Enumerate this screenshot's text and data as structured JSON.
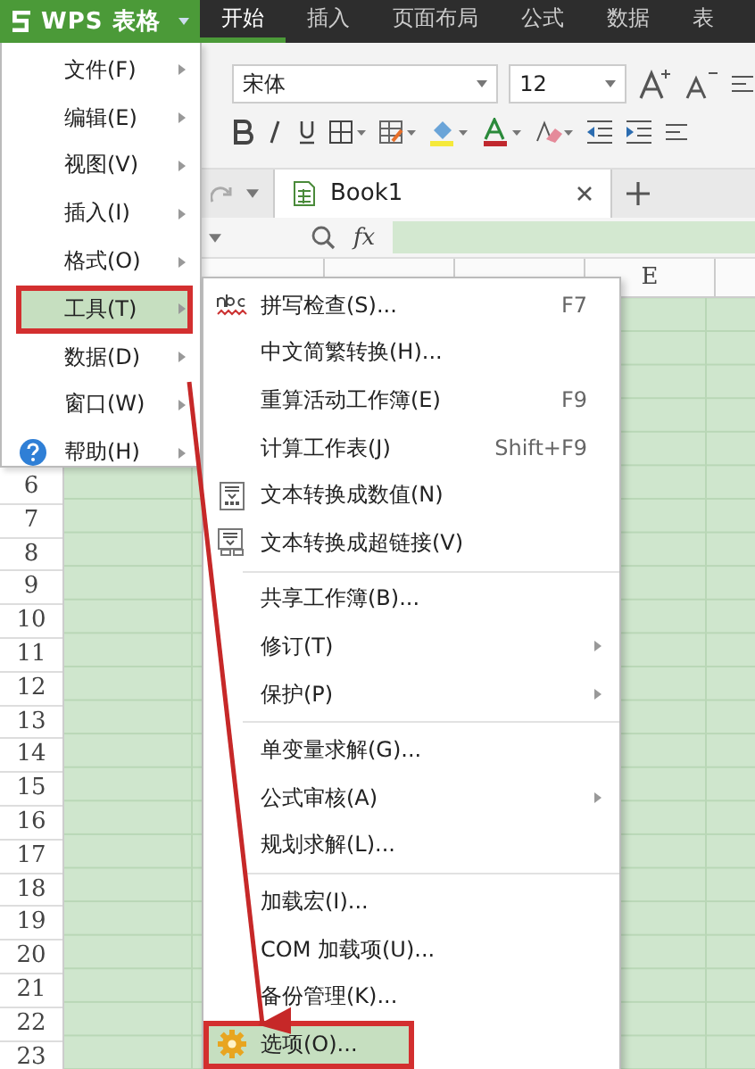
{
  "app_button": {
    "label": "WPS 表格"
  },
  "ribbon_tabs": [
    {
      "label": "开始",
      "selected": true
    },
    {
      "label": "插入",
      "selected": false
    },
    {
      "label": "页面布局",
      "selected": false
    },
    {
      "label": "公式",
      "selected": false
    },
    {
      "label": "数据",
      "selected": false
    },
    {
      "label": "表",
      "selected": false
    }
  ],
  "ribbon": {
    "font": "宋体",
    "font_size": "12"
  },
  "document_tab": {
    "title": "Book1"
  },
  "formula_bar": {
    "fx": "fx"
  },
  "columns": [
    "E"
  ],
  "row_numbers": [
    "6",
    "7",
    "8",
    "9",
    "10",
    "11",
    "12",
    "13",
    "14",
    "15",
    "16",
    "17",
    "18",
    "19",
    "20",
    "21",
    "22",
    "23"
  ],
  "app_menu": [
    {
      "label": "文件(F)",
      "kind": "plain",
      "selected": false
    },
    {
      "label": "编辑(E)",
      "kind": "plain",
      "selected": false
    },
    {
      "label": "视图(V)",
      "kind": "plain",
      "selected": false
    },
    {
      "label": "插入(I)",
      "kind": "plain",
      "selected": false
    },
    {
      "label": "格式(O)",
      "kind": "plain",
      "selected": false
    },
    {
      "label": "工具(T)",
      "kind": "plain",
      "selected": true
    },
    {
      "label": "数据(D)",
      "kind": "plain",
      "selected": false
    },
    {
      "label": "窗口(W)",
      "kind": "plain",
      "selected": false
    },
    {
      "label": "帮助(H)",
      "kind": "help",
      "selected": false
    }
  ],
  "tools_menu": [
    [
      {
        "label": "拼写检查(S)...",
        "shortcut": "F7",
        "kind": "spell",
        "submenu": false,
        "selected": false
      },
      {
        "label": "中文简繁转换(H)...",
        "kind": "plain",
        "submenu": false,
        "selected": false
      },
      {
        "label": "重算活动工作簿(E)",
        "shortcut": "F9",
        "kind": "plain",
        "submenu": false,
        "selected": false
      },
      {
        "label": "计算工作表(J)",
        "shortcut": "Shift+F9",
        "kind": "plain",
        "submenu": false,
        "selected": false
      },
      {
        "label": "文本转换成数值(N)",
        "kind": "to-number",
        "submenu": false,
        "selected": false
      },
      {
        "label": "文本转换成超链接(V)",
        "kind": "to-link",
        "submenu": false,
        "selected": false
      }
    ],
    [
      {
        "label": "共享工作簿(B)...",
        "kind": "plain",
        "submenu": false,
        "selected": false
      },
      {
        "label": "修订(T)",
        "kind": "plain",
        "submenu": true,
        "selected": false
      },
      {
        "label": "保护(P)",
        "kind": "plain",
        "submenu": true,
        "selected": false
      }
    ],
    [
      {
        "label": "单变量求解(G)...",
        "kind": "plain",
        "submenu": false,
        "selected": false
      },
      {
        "label": "公式审核(A)",
        "kind": "plain",
        "submenu": true,
        "selected": false
      },
      {
        "label": "规划求解(L)...",
        "kind": "plain",
        "submenu": false,
        "selected": false
      }
    ],
    [
      {
        "label": "加载宏(I)...",
        "kind": "plain",
        "submenu": false,
        "selected": false
      },
      {
        "label": "COM 加载项(U)...",
        "kind": "plain",
        "submenu": false,
        "selected": false
      },
      {
        "label": "备份管理(K)...",
        "kind": "plain",
        "submenu": false,
        "selected": false
      },
      {
        "label": "选项(O)...",
        "kind": "gear",
        "submenu": false,
        "selected": true
      }
    ]
  ]
}
